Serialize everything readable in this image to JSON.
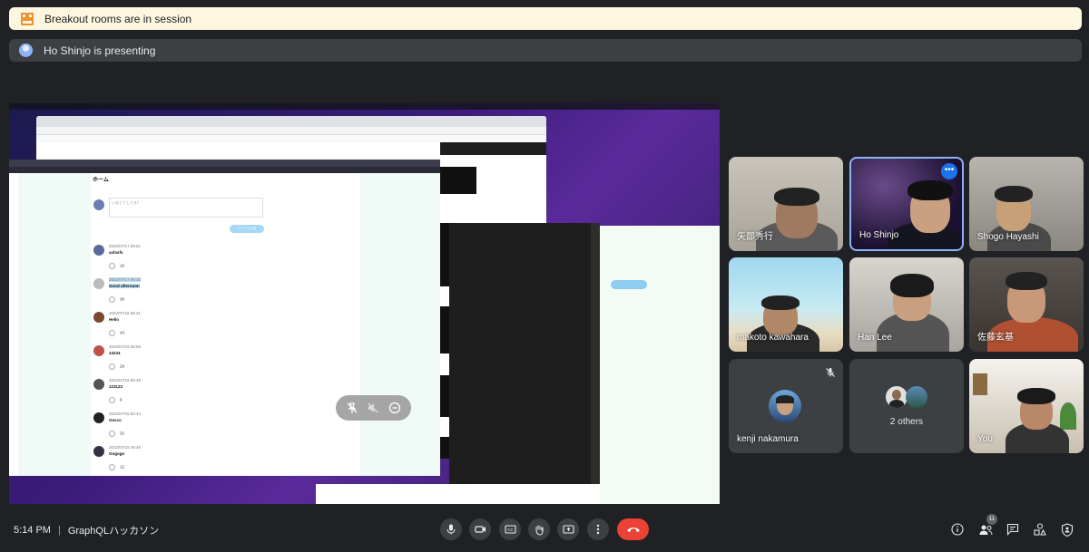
{
  "banners": {
    "breakout": "Breakout rooms are in session",
    "presenting": "Ho Shinjo is presenting"
  },
  "screen_share": {
    "page_heading": "ホーム",
    "compose_placeholder": "いまどうしてる？",
    "tweet_button": "ツイートする",
    "posts": [
      {
        "date": "2022/07/17 09:51",
        "text": "asfasfs",
        "likes": "16"
      },
      {
        "date": "2022/07/17 09:10",
        "text": "Good afternoon",
        "likes": "36"
      },
      {
        "date": "2022/07/16 56:21",
        "text": "Hello",
        "likes": "43"
      },
      {
        "date": "2022/07/16 55:55",
        "text": "24234",
        "likes": "28"
      },
      {
        "date": "2022/07/16 55:48",
        "text": "123123",
        "likes": "9"
      },
      {
        "date": "2022/07/16 52:44",
        "text": "Gecco",
        "likes": "32"
      },
      {
        "date": "2022/07/16 46:48",
        "text": "Gogogo",
        "likes": "12"
      }
    ]
  },
  "participants": [
    {
      "name": "矢部秀行"
    },
    {
      "name": "Ho Shinjo",
      "active": true
    },
    {
      "name": "Shogo Hayashi"
    },
    {
      "name": "makoto kawahara"
    },
    {
      "name": "Han Lee"
    },
    {
      "name": "佐藤玄基"
    },
    {
      "name": "kenji nakamura",
      "muted": true
    },
    {
      "name": "2 others"
    },
    {
      "name": "You"
    }
  ],
  "footer": {
    "time": "5:14 PM",
    "separator": "|",
    "meeting_title": "GraphQLハッカソン",
    "participant_count": "11"
  },
  "colors": {
    "background": "#202124",
    "hangup": "#ea4335",
    "accent": "#8ab4f8",
    "breakout_banner": "#fef7e0"
  }
}
